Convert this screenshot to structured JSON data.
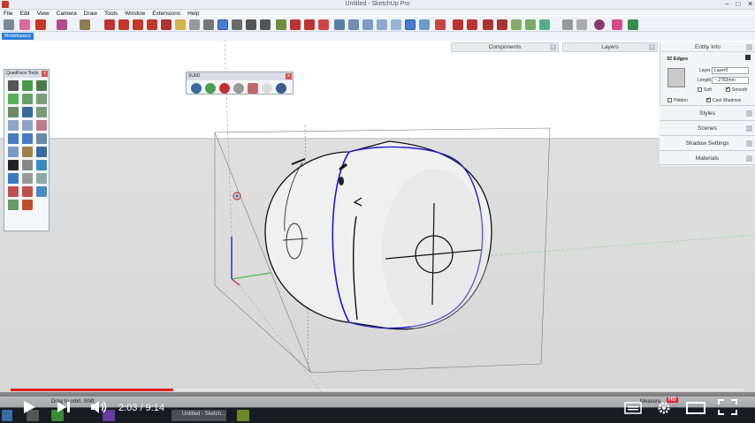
{
  "window": {
    "title": "Untitled - SketchUp Pro"
  },
  "menu": [
    "File",
    "Edit",
    "View",
    "Camera",
    "Draw",
    "Tools",
    "Window",
    "Extensions",
    "Help"
  ],
  "scene_tab": "Modelspace",
  "trays": {
    "components": "Components",
    "layers": "Layers",
    "entity_info": {
      "title": "Entity Info",
      "edges": "32 Edges",
      "layer_label": "Layer:",
      "layer_value": "Layer0",
      "length_label": "Length:",
      "length_value": "~ 2762mm",
      "soft_label": "Soft",
      "smooth_label": "Smooth",
      "hidden_label": "Hidden",
      "cast_shadows_label": "Cast Shadows"
    },
    "styles": "Styles",
    "scenes": "Scenes",
    "shadow_settings": "Shadow Settings",
    "materials": "Materials"
  },
  "quadface": {
    "title": "QuadFace Tools"
  },
  "subd": {
    "title": "SUbD"
  },
  "status": {
    "left": "Drag to orbit. Shift",
    "right": "Measure"
  },
  "player": {
    "current_time": "2:03",
    "separator": "/",
    "duration": "9:14",
    "progress": 0.2224,
    "hd_label": "HD"
  },
  "taskbar": {
    "app_label": "Untitled - Sketch..."
  },
  "colors": {
    "accent": "#2d7fd6",
    "progress": "#e02020",
    "edge_blue": "#1c1cc8"
  }
}
